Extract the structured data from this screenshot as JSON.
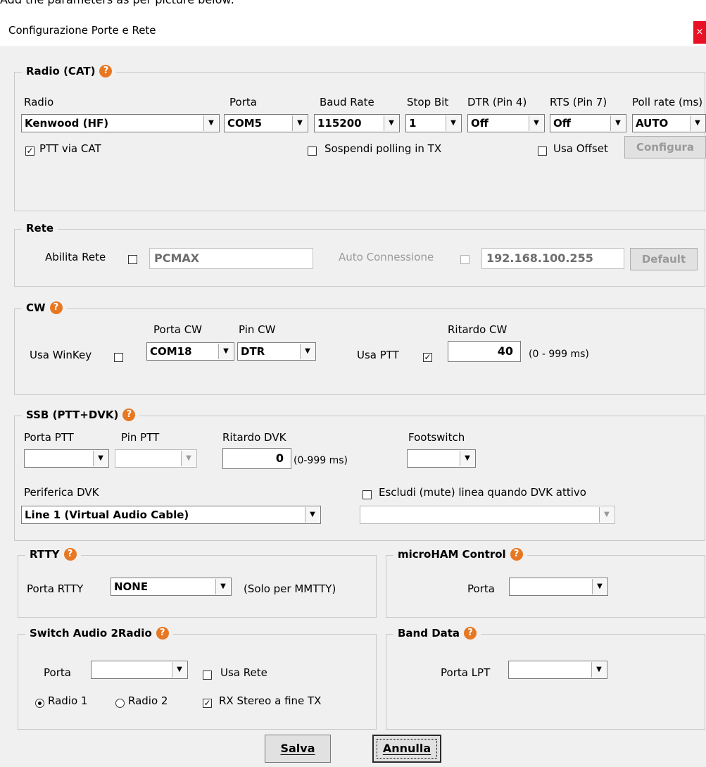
{
  "caption": "Add the parameters as per picture below:",
  "window": {
    "title": "Configurazione Porte e Rete",
    "close": "×"
  },
  "icons": {
    "help": "question-mark-icon",
    "dropdown": "chevron-down-icon"
  },
  "cat": {
    "legend": "Radio (CAT)",
    "labels": {
      "radio": "Radio",
      "porta": "Porta",
      "baud": "Baud Rate",
      "stop": "Stop Bit",
      "dtr": "DTR (Pin 4)",
      "rts": "RTS (Pin 7)",
      "poll": "Poll rate (ms)"
    },
    "values": {
      "radio": "Kenwood (HF)",
      "porta": "COM5",
      "baud": "115200",
      "stop": "1",
      "dtr": "Off",
      "rts": "Off",
      "poll": "AUTO"
    },
    "ptt_via_cat": {
      "label": "PTT via CAT",
      "checked": true
    },
    "sospendi": {
      "label": "Sospendi polling in TX",
      "checked": false
    },
    "usa_offset": {
      "label": "Usa Offset",
      "checked": false
    },
    "configura": "Configura"
  },
  "rete": {
    "legend": "Rete",
    "abilita_label": "Abilita Rete",
    "name": "PCMAX",
    "auto_label": "Auto Connessione",
    "ip": "192.168.100.255",
    "default_btn": "Default"
  },
  "cw": {
    "legend": "CW",
    "winkey_label": "Usa WinKey",
    "porta_label": "Porta CW",
    "porta": "COM18",
    "pin_label": "Pin CW",
    "pin": "DTR",
    "usa_ptt_label": "Usa PTT",
    "usa_ptt": true,
    "ritardo_label": "Ritardo CW",
    "ritardo": "40",
    "range": "(0 - 999 ms)"
  },
  "ssb": {
    "legend": "SSB (PTT+DVK)",
    "porta_ptt_label": "Porta PTT",
    "porta_ptt": "",
    "pin_ptt_label": "Pin PTT",
    "pin_ptt": "",
    "ritardo_label": "Ritardo DVK",
    "ritardo": "0",
    "range": "(0-999 ms)",
    "footswitch_label": "Footswitch",
    "footswitch": "",
    "periferica_label": "Periferica DVK",
    "periferica": "Line 1 (Virtual Audio Cable)",
    "escludi_label": "Escludi (mute) linea quando DVK attivo",
    "escludi_linea": ""
  },
  "rtty": {
    "legend": "RTTY",
    "porta_label": "Porta RTTY",
    "porta": "NONE",
    "note": "(Solo per MMTTY)"
  },
  "microham": {
    "legend": "microHAM Control",
    "porta_label": "Porta",
    "porta": ""
  },
  "switch": {
    "legend": "Switch Audio 2Radio",
    "porta_label": "Porta",
    "porta": "",
    "usa_rete": "Usa Rete",
    "radio1": "Radio 1",
    "radio2": "Radio 2",
    "rx_stereo": "RX Stereo a fine TX",
    "rx_stereo_checked": true
  },
  "band": {
    "legend": "Band Data",
    "porta_lpt_label": "Porta LPT",
    "porta_lpt": ""
  },
  "buttons": {
    "salva": "Salva",
    "annulla": "Annulla"
  }
}
